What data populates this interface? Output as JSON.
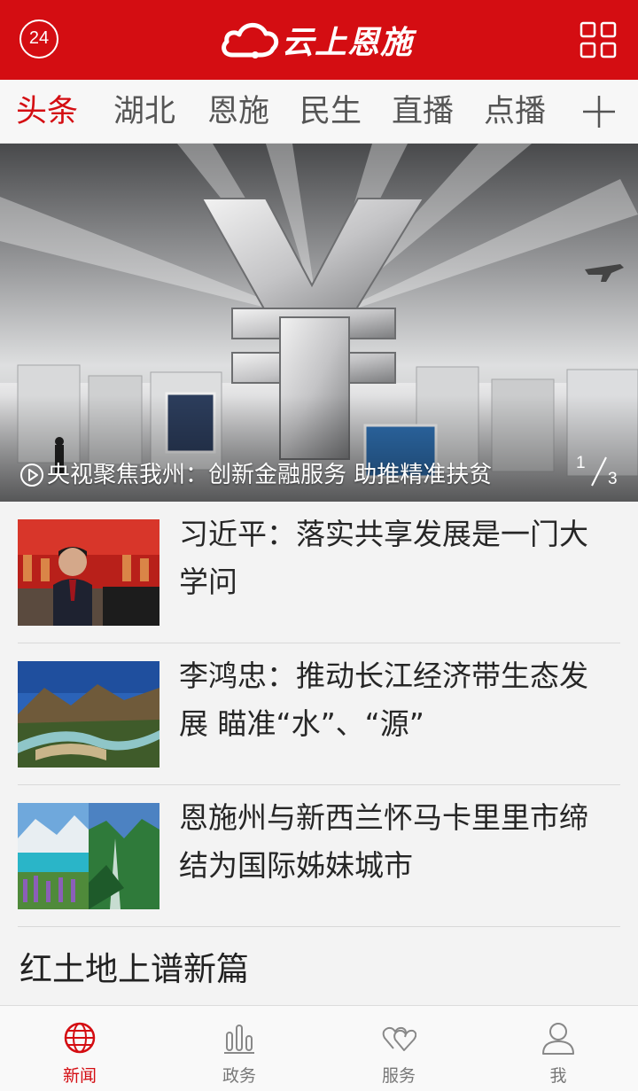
{
  "header": {
    "badge": "24",
    "app_name": "云上恩施",
    "grid_icon": "grid-icon"
  },
  "tabs": [
    {
      "label": "头条",
      "active": true
    },
    {
      "label": "湖北",
      "active": false
    },
    {
      "label": "恩施",
      "active": false
    },
    {
      "label": "民生",
      "active": false
    },
    {
      "label": "直播",
      "active": false
    },
    {
      "label": "点播",
      "active": false
    }
  ],
  "add_channel_icon": "plus-icon",
  "hero": {
    "title": "央视聚焦我州：创新金融服务 助推精准扶贫",
    "video_icon": "play-circle-icon",
    "page_current": "1",
    "page_total": "3"
  },
  "news": [
    {
      "title": "习近平：落实共享发展是一门大学问",
      "thumb": "photo-of-speaker"
    },
    {
      "title": "李鸿忠：推动长江经济带生态发展 瞄准“水”、“源”",
      "thumb": "river-landscape"
    },
    {
      "title": "恩施州与新西兰怀马卡里里市缔结为国际姊妹城市",
      "thumb": "lake-and-mountains"
    }
  ],
  "section": {
    "title": "红土地上谱新篇"
  },
  "bottom_nav": [
    {
      "label": "新闻",
      "icon": "globe-icon",
      "active": true
    },
    {
      "label": "政务",
      "icon": "bars-icon",
      "active": false
    },
    {
      "label": "服务",
      "icon": "hearts-icon",
      "active": false
    },
    {
      "label": "我",
      "icon": "user-icon",
      "active": false
    }
  ],
  "colors": {
    "brand": "#d40d12",
    "text": "#262626",
    "muted": "#777777"
  }
}
